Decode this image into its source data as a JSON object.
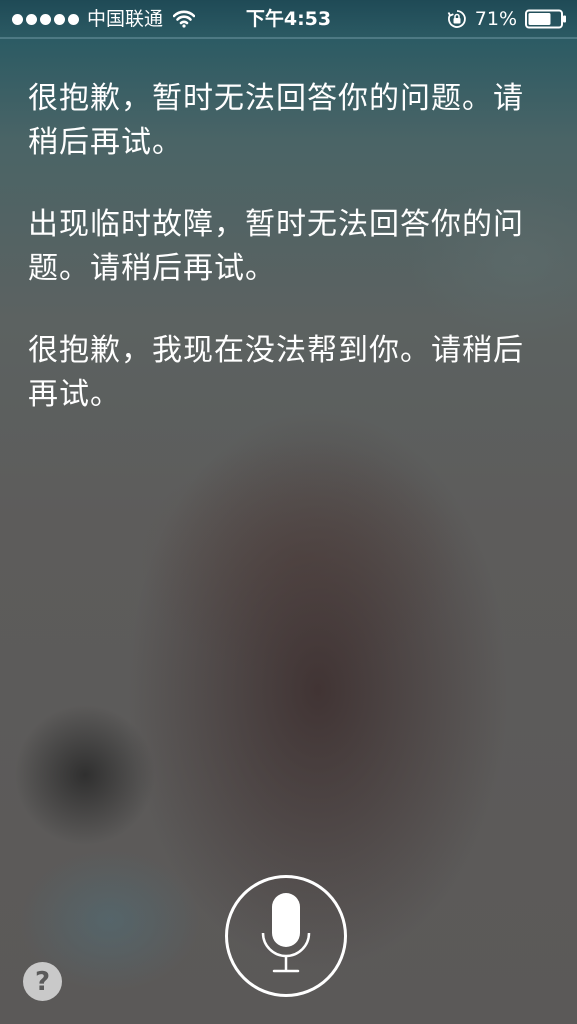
{
  "status_bar": {
    "carrier": "中国联通",
    "time": "下午4:53",
    "battery_percent": "71%",
    "battery_level": 0.71,
    "signal_dots": 5,
    "icons": [
      "signal-dots",
      "wifi-icon",
      "orientation-lock-icon",
      "battery-icon"
    ]
  },
  "responses": [
    "很抱歉，暂时无法回答你的问题。请稍后再试。",
    "出现临时故障，暂时无法回答你的问题。请稍后再试。",
    "很抱歉，我现在没法帮到你。请稍后再试。"
  ],
  "controls": {
    "help_label": "?",
    "mic_icon": "microphone-icon"
  },
  "colors": {
    "text": "#ffffff",
    "top_tint": "#1f4a56",
    "background": "#5b5958"
  }
}
